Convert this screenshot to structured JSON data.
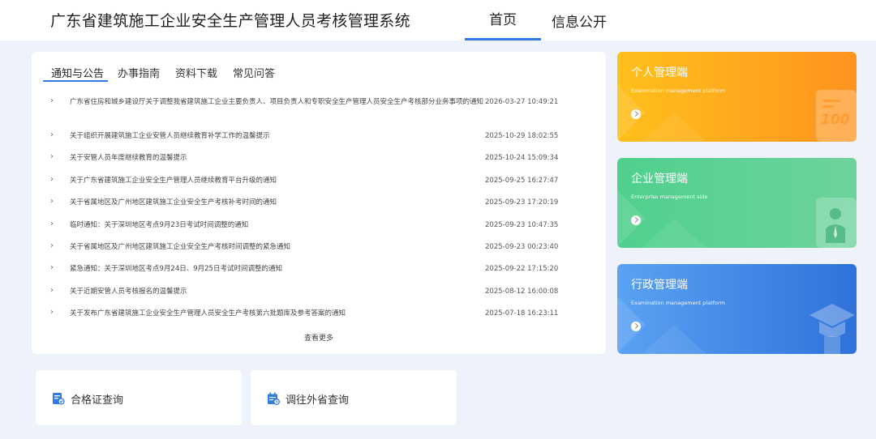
{
  "header": {
    "site_title": "广东省建筑施工企业安全生产管理人员考核管理系统",
    "nav": [
      {
        "label": "首页",
        "active": true
      },
      {
        "label": "信息公开",
        "active": false
      }
    ],
    "accent_color": "#2f7ae5"
  },
  "news": {
    "tabs": [
      {
        "label": "通知与公告",
        "active": true
      },
      {
        "label": "办事指南",
        "active": false
      },
      {
        "label": "资料下载",
        "active": false
      },
      {
        "label": "常见问答",
        "active": false
      }
    ],
    "items": [
      {
        "title": "广东省住房和城乡建设厅关于调整我省建筑施工企业主要负责人、项目负责人和专职安全生产管理人员安全生产考核部分业务事项的通知",
        "date": "2026-03-27 10:49:21"
      },
      {
        "title": "关于组织开展建筑施工企业安管人员继续教育补学工作的温馨提示",
        "date": "2025-10-29 18:02:55"
      },
      {
        "title": "关于安管人员年度继续教育的温馨提示",
        "date": "2025-10-24 15:09:34"
      },
      {
        "title": "关于广东省建筑施工企业安全生产管理人员继续教育平台升级的通知",
        "date": "2025-09-25 16:27:47"
      },
      {
        "title": "关于省属地区及广州地区建筑施工企业安全生产考核补考时间的通知",
        "date": "2025-09-23 17:20:19"
      },
      {
        "title": "临时通知：关于深圳地区考点9月23日考试时间调整的通知",
        "date": "2025-09-23 10:47:35"
      },
      {
        "title": "关于省属地区及广州地区建筑施工企业安全生产考核时间调整的紧急通知",
        "date": "2025-09-23 00:23:40"
      },
      {
        "title": "紧急通知：关于深圳地区考点9月24日、9月25日考试时间调整的通知",
        "date": "2025-09-22 17:15:20"
      },
      {
        "title": "关于近期安管人员考核报名的温馨提示",
        "date": "2025-08-12 16:00:08"
      },
      {
        "title": "关于发布广东省建筑施工企业安全生产管理人员安全生产考核第六批题库及参考答案的通知",
        "date": "2025-07-18 16:23:11"
      }
    ],
    "more_label": "查看更多"
  },
  "portals": [
    {
      "title": "个人管理端",
      "subtitle": "Examination management platform",
      "icon": "score-100-icon",
      "color": "#ffa51e"
    },
    {
      "title": "企业管理端",
      "subtitle": "Enterprise management side",
      "icon": "businessman-icon",
      "color": "#4fd08d"
    },
    {
      "title": "行政管理端",
      "subtitle": "Examination management platform",
      "icon": "graduation-cap-icon",
      "color": "#2f72da"
    }
  ],
  "quick_links": [
    {
      "label": "合格证查询",
      "icon": "certificate-query-icon"
    },
    {
      "label": "调往外省查询",
      "icon": "calendar-query-icon"
    }
  ]
}
